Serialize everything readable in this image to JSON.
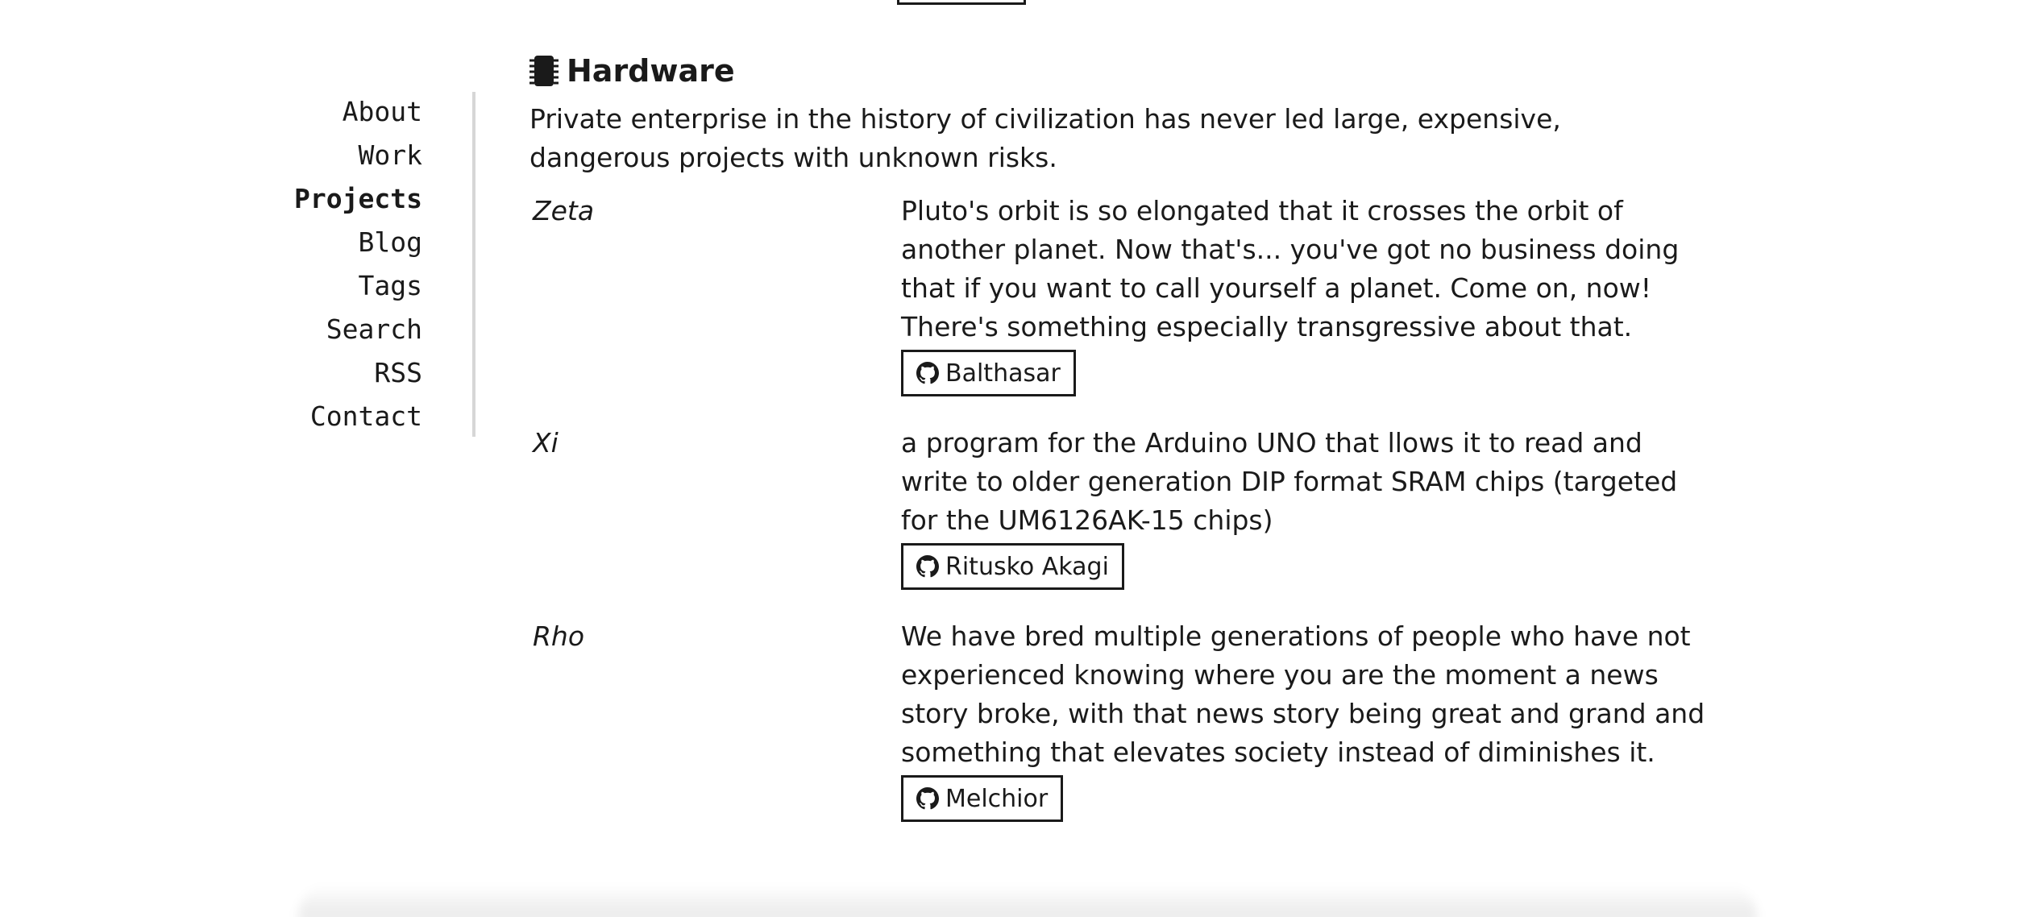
{
  "nav": {
    "items": [
      {
        "label": "About",
        "active": false
      },
      {
        "label": "Work",
        "active": false
      },
      {
        "label": "Projects",
        "active": true
      },
      {
        "label": "Blog",
        "active": false
      },
      {
        "label": "Tags",
        "active": false
      },
      {
        "label": "Search",
        "active": false
      },
      {
        "label": "RSS",
        "active": false
      },
      {
        "label": "Contact",
        "active": false
      }
    ]
  },
  "section": {
    "icon": "chip-icon",
    "title": "Hardware",
    "intro": "Private enterprise in the history of civilization has never led large, expensive, dangerous projects with unknown risks."
  },
  "projects": [
    {
      "name": "Zeta",
      "description": "Pluto's orbit is so elongated that it crosses the orbit of another planet. Now that's... you've got no business doing that if you want to call yourself a planet. Come on, now! There's something especially transgressive about that.",
      "button_icon": "github-icon",
      "button_label": "Balthasar"
    },
    {
      "name": "Xi",
      "description": "a program for the Arduino UNO that llows it to read and write to older generation DIP format SRAM chips (targeted for the UM6126AK-15 chips)",
      "button_icon": "github-icon",
      "button_label": "Ritusko Akagi"
    },
    {
      "name": "Rho",
      "description": "We have bred multiple generations of people who have not experienced knowing where you are the moment a news story broke, with that news story being great and grand and something that elevates society instead of diminishes it.",
      "button_icon": "github-icon",
      "button_label": "Melchior"
    }
  ]
}
